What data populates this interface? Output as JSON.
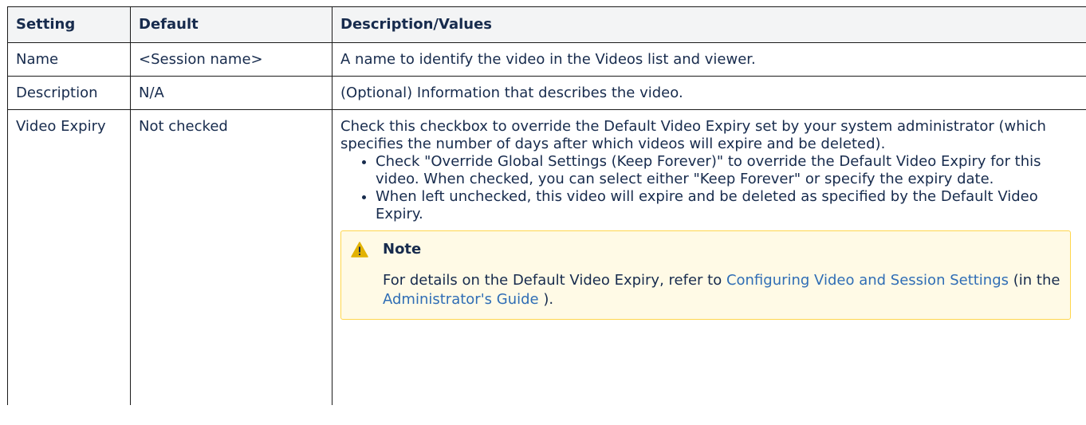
{
  "table": {
    "headers": [
      "Setting",
      "Default",
      "Description/Values"
    ],
    "rows": [
      {
        "setting": "Name",
        "default": "<Session name>",
        "description": "A name to identify the video in the Videos list and viewer."
      },
      {
        "setting": "Description",
        "default": "N/A",
        "description": "(Optional) Information that describes the video."
      },
      {
        "setting": "Video Expiry",
        "default": "Not checked",
        "description": "Check this checkbox to override the Default Video Expiry set by your system administrator (which specifies the number of days after which videos will expire and be deleted).",
        "bullets": [
          "Check \"Override Global Settings (Keep Forever)\" to override the Default Video Expiry for this video. When checked, you can select either \"Keep Forever\" or specify the expiry date.",
          "When left unchecked, this video will expire and be deleted as specified by the Default Video Expiry."
        ],
        "note": {
          "icon": "warning-icon",
          "title": "Note",
          "text_before": "For details on the Default Video Expiry, refer to ",
          "link1": "Configuring Video and Session Settings",
          "text_middle": " (in the ",
          "link2": "Administrator's Guide",
          "text_after": " )."
        }
      }
    ]
  },
  "colors": {
    "header_bg": "#f3f4f5",
    "note_bg": "#fffae6",
    "note_border": "#ffd64d",
    "link": "#2f6db5",
    "warning_icon": "#e2b203"
  }
}
